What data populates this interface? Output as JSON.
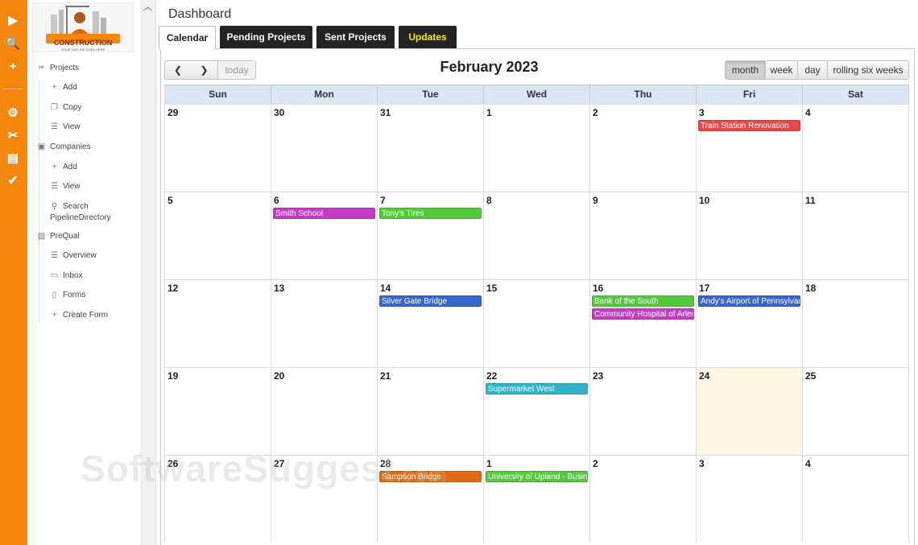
{
  "rail": {
    "icons": [
      {
        "name": "brand-icon",
        "glyph": "▶"
      },
      {
        "name": "search-icon",
        "glyph": "🔍"
      },
      {
        "name": "plus-icon",
        "glyph": "+"
      },
      {
        "name": "gears-icon",
        "glyph": "⚙"
      },
      {
        "name": "tools-icon",
        "glyph": "✂"
      },
      {
        "name": "contact-card-icon",
        "glyph": "▤"
      },
      {
        "name": "clipboard-check-icon",
        "glyph": "✔"
      }
    ]
  },
  "logo": {
    "text": "CONSTRUCTION",
    "tagline": "YOUR TAGLINE GOES HERE"
  },
  "sidebar": {
    "projects": {
      "label": "Projects",
      "icon": "✂",
      "add": "Add",
      "copy": "Copy",
      "view": "View"
    },
    "companies": {
      "label": "Companies",
      "icon": "▣",
      "add": "Add",
      "view": "View",
      "search_line1": "Search",
      "search_line2": "PipelineDirectory"
    },
    "prequal": {
      "label": "PreQual",
      "icon": "▨",
      "overview": "Overview",
      "inbox": "Inbox",
      "forms": "Forms",
      "create_form": "Create Form"
    }
  },
  "page": {
    "title": "Dashboard"
  },
  "tabs": {
    "calendar": "Calendar",
    "pending": "Pending Projects",
    "sent": "Sent Projects",
    "updates": "Updates"
  },
  "colors": {
    "updates_text": "#ffe600",
    "accent": "#f5870f"
  },
  "calendar": {
    "title": "February 2023",
    "prev_glyph": "❮",
    "next_glyph": "❯",
    "today": "today",
    "views": {
      "month": "month",
      "week": "week",
      "day": "day",
      "rolling": "rolling six weeks"
    },
    "active_view": "month",
    "dow": [
      "Sun",
      "Mon",
      "Tue",
      "Wed",
      "Thu",
      "Fri",
      "Sat"
    ],
    "weeks": [
      [
        {
          "n": "29"
        },
        {
          "n": "30"
        },
        {
          "n": "31"
        },
        {
          "n": "1"
        },
        {
          "n": "2"
        },
        {
          "n": "3",
          "events": [
            {
              "t": "Train Station Renovation",
              "c": "#e84848"
            }
          ]
        },
        {
          "n": "4"
        }
      ],
      [
        {
          "n": "5"
        },
        {
          "n": "6",
          "events": [
            {
              "t": "Smith School",
              "c": "#c33cc6"
            }
          ]
        },
        {
          "n": "7",
          "events": [
            {
              "t": "Tony's Tires",
              "c": "#55c93b"
            }
          ]
        },
        {
          "n": "8"
        },
        {
          "n": "9"
        },
        {
          "n": "10"
        },
        {
          "n": "11"
        }
      ],
      [
        {
          "n": "12"
        },
        {
          "n": "13"
        },
        {
          "n": "14",
          "events": [
            {
              "t": "Silver Gate Bridge",
              "c": "#3567cc"
            }
          ]
        },
        {
          "n": "15"
        },
        {
          "n": "16",
          "events": [
            {
              "t": "Bank of the South",
              "c": "#55c93b"
            },
            {
              "t": "Community Hospital of Arlen",
              "c": "#c33cc6"
            }
          ]
        },
        {
          "n": "17",
          "events": [
            {
              "t": "Andy's Airport of Pennsylvania",
              "c": "#3567cc"
            }
          ]
        },
        {
          "n": "18"
        }
      ],
      [
        {
          "n": "19"
        },
        {
          "n": "20"
        },
        {
          "n": "21"
        },
        {
          "n": "22",
          "events": [
            {
              "t": "Supermarket West",
              "c": "#32b3c8"
            }
          ]
        },
        {
          "n": "23"
        },
        {
          "n": "24",
          "today": true
        },
        {
          "n": "25"
        }
      ],
      [
        {
          "n": "26"
        },
        {
          "n": "27"
        },
        {
          "n": "28",
          "events": [
            {
              "t": "Sampson Bridge",
              "c": "#e06b10"
            }
          ]
        },
        {
          "n": "1",
          "events": [
            {
              "t": "University of Upland - Business",
              "c": "#55c93b"
            }
          ]
        },
        {
          "n": "2"
        },
        {
          "n": "3"
        },
        {
          "n": "4"
        }
      ]
    ]
  },
  "watermark": {
    "text": "SoftwareSuggest",
    ".com": ".com"
  }
}
